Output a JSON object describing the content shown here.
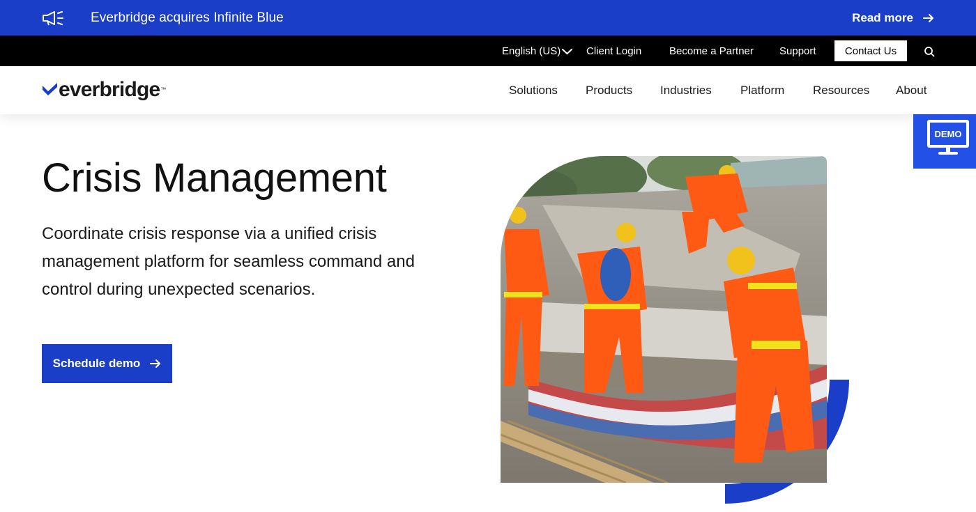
{
  "announcement": {
    "icon": "megaphone-icon",
    "message": "Everbridge acquires Infinite Blue",
    "read_more": "Read more"
  },
  "utility_nav": {
    "language": "English (US)",
    "client_login": "Client Login",
    "become_partner": "Become a Partner",
    "support": "Support",
    "contact": "Contact Us",
    "search_icon": "search-icon"
  },
  "brand": {
    "name": "everbridge",
    "trademark": "™",
    "accent": "#1a3ec8"
  },
  "main_nav": {
    "items": [
      {
        "label": "Solutions"
      },
      {
        "label": "Products"
      },
      {
        "label": "Industries"
      },
      {
        "label": "Platform"
      },
      {
        "label": "Resources"
      },
      {
        "label": "About"
      }
    ]
  },
  "demo_tab": {
    "label": "DEMO",
    "icon": "monitor-icon",
    "color": "#2350e6"
  },
  "hero": {
    "title": "Crisis Management",
    "subtitle": "Coordinate crisis response via a unified crisis management platform for seamless command and control during unexpected scenarios.",
    "cta": "Schedule demo"
  },
  "colors": {
    "primary_blue": "#1a3ec8",
    "black_bar": "#000000",
    "rescue_orange": "#ff5a14"
  }
}
